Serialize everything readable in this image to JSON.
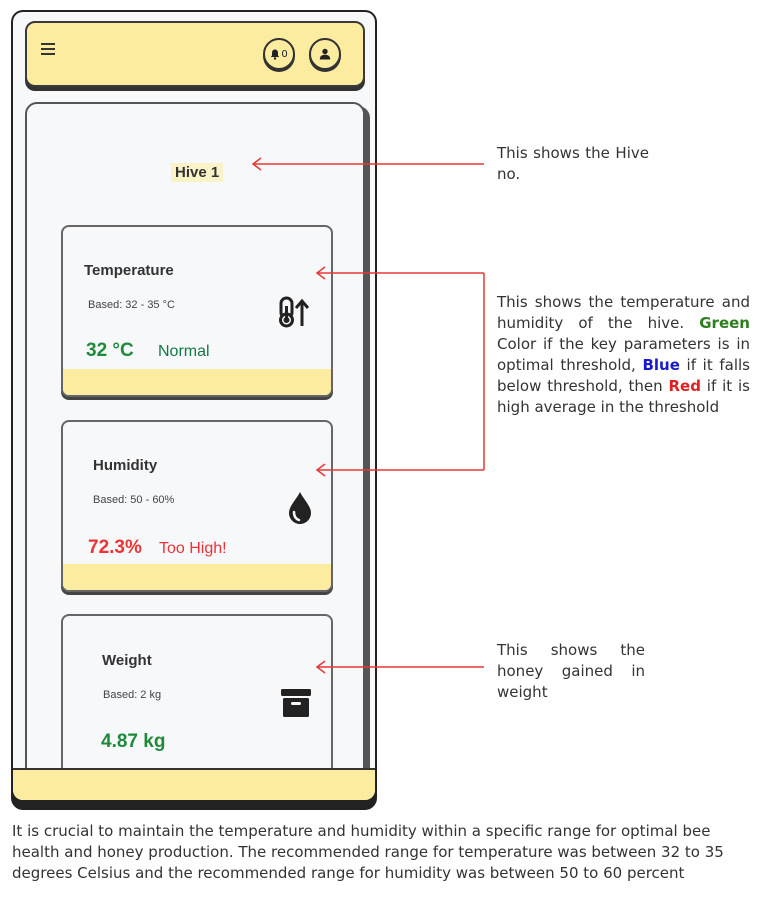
{
  "app": {
    "notification_count": "0",
    "hive_title": "Hive 1"
  },
  "cards": [
    {
      "title": "Temperature",
      "based": "Based: 32 - 35 °C",
      "value": "32 °C",
      "status": "Normal",
      "value_color": "#1f8a3a",
      "status_color": "#127a47",
      "icon": "thermometer-up-icon"
    },
    {
      "title": "Humidity",
      "based": "Based: 50 - 60%",
      "value": "72.3%",
      "status": "Too High!",
      "value_color": "#ee3333",
      "status_color": "#ee3333",
      "icon": "water-drop-icon"
    },
    {
      "title": "Weight",
      "based": "Based: 2 kg",
      "value": "4.87 kg",
      "value_color": "#1f8a3a",
      "icon": "archive-box-icon"
    }
  ],
  "notes": {
    "hive_no": "This shows the Hive no.",
    "temp_humidity_prefix": "This shows the temperature and humidity of the hive.",
    "green_word": "Green",
    "after_green": " Color if the key parameters is in optimal threshold,",
    "blue_word": "Blue",
    "after_blue": " if it falls below threshold, then",
    "red_word": "Red",
    "after_red": " if it is high average in the threshold",
    "weight": "This shows the honey gained in weight"
  },
  "caption": "It is crucial to maintain the temperature and humidity within a specific range for optimal bee health and honey production. The recommended range for temperature was between 32 to 35 degrees Celsius and the recommended range for humidity was between 50 to 60 percent",
  "colors": {
    "accent_yellow": "#fbeca0",
    "arrow_red": "#e53935",
    "good_green": "#1f8a3a",
    "alert_red": "#ee3333"
  }
}
